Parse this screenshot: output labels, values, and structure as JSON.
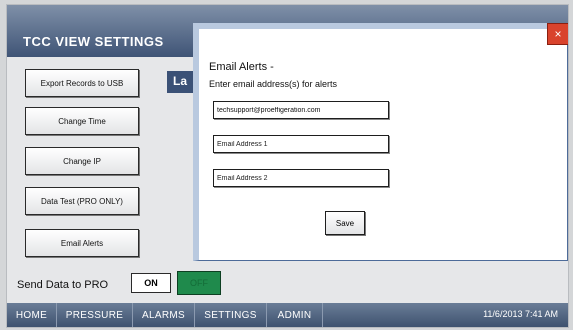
{
  "header": {
    "title": "TCC VIEW SETTINGS"
  },
  "sidebar": {
    "buttons": [
      "Export Records to USB",
      "Change Time",
      "Change IP",
      "Data Test (PRO ONLY)",
      "Email Alerts"
    ]
  },
  "behind_panel": {
    "tab_label": "La"
  },
  "send_data": {
    "label": "Send Data to PRO",
    "on_label": "ON",
    "off_label": "OFF"
  },
  "modal": {
    "title": "Email Alerts -",
    "subtitle": "Enter email address(s) for alerts",
    "fields": [
      {
        "value": "techsupport@proeffigeration.com",
        "placeholder": ""
      },
      {
        "value": "",
        "placeholder": "Email Address 1"
      },
      {
        "value": "",
        "placeholder": "Email Address 2"
      }
    ],
    "save_label": "Save",
    "close_label": "×"
  },
  "nav": {
    "items": [
      "HOME",
      "PRESSURE",
      "ALARMS",
      "SETTINGS",
      "ADMIN"
    ],
    "clock": "11/6/2013 7:41 AM"
  },
  "colors": {
    "header": "#3f5476",
    "nav": "#3e526f",
    "off_toggle": "#1f8a4c",
    "close_button": "#d9432c"
  }
}
